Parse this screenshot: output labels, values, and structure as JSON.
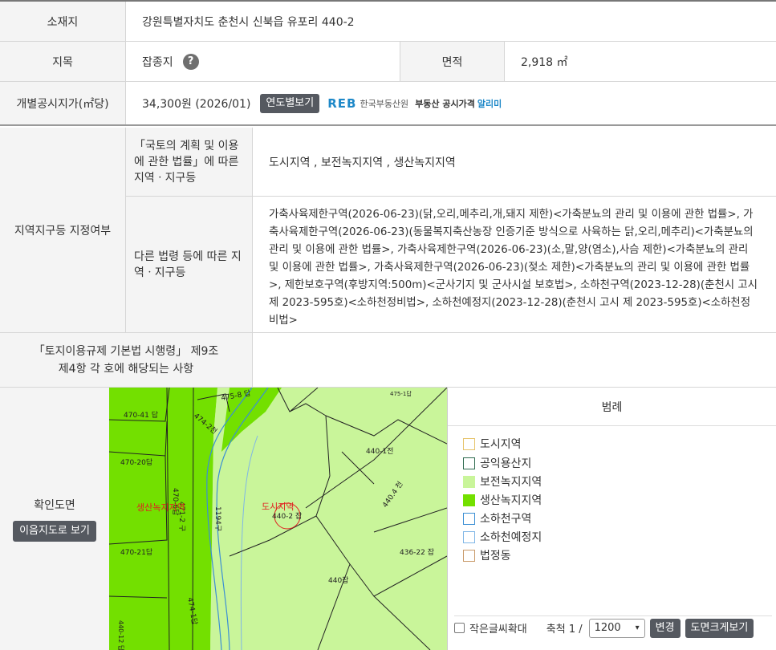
{
  "location": {
    "label": "소재지",
    "value": "강원특별자치도 춘천시 신북읍 유포리 440-2"
  },
  "land_category": {
    "label": "지목",
    "value": "잡종지",
    "help_icon": "question-circle-icon",
    "help_glyph": "?"
  },
  "area": {
    "label": "면적",
    "value": "2,918 ㎡"
  },
  "official_price": {
    "label": "개별공시지가(㎡당)",
    "value": "34,300원 (2026/01)",
    "button": "연도별보기",
    "reb_mark": "RE",
    "reb_mark_accent": "B",
    "reb_name": "한국부동산원",
    "reb_service": "부동산 공시가격",
    "reb_service_accent": "알리미"
  },
  "zoning": {
    "label": "지역지구등 지정여부",
    "national_plan_label": "「국토의 계획 및 이용에 관한 법률」에 따른 지역ㆍ지구등",
    "national_plan_value": "도시지역 , 보전녹지지역 , 생산녹지지역",
    "other_laws_label": "다른 법령 등에 따른 지역ㆍ지구등",
    "other_laws_value": "가축사육제한구역(2026-06-23)(닭,오리,메추리,개,돼지 제한)<가축분뇨의 관리 및 이용에 관한 법률>, 가축사육제한구역(2026-06-23)(동물복지축산농장 인증기준 방식으로 사육하는 닭,오리,메추리)<가축분뇨의 관리 및 이용에 관한 법률>, 가축사육제한구역(2026-06-23)(소,말,양(염소),사슴 제한)<가축분뇨의 관리 및 이용에 관한 법률>, 가축사육제한구역(2026-06-23)(젖소 제한)<가축분뇨의 관리 및 이용에 관한 법률>, 제한보호구역(후방지역:500m)<군사기지 및 군사시설 보호법>, 소하천구역(2023-12-28)(춘천시 고시 제 2023-595호)<소하천정비법>, 소하천예정지(2023-12-28)(춘천시 고시 제 2023-595호)<소하천정비법>"
  },
  "enforcement": {
    "label": "「토지이용규제 기본법 시행령」 제9조 제4항 각 호에 해당되는 사항",
    "value": ""
  },
  "map_section": {
    "label": "확인도면",
    "view_button": "이음지도로 보기",
    "parcels": [
      "470-41 답",
      "470-20답",
      "470-21답",
      "470-6답",
      "475-8 답",
      "474-2천",
      "440-1전",
      "440-2 잡",
      "440.4 천",
      "436-22 잡",
      "440잡",
      "1194구",
      "471-2 구",
      "474-1답",
      "475-1답",
      "440-12 답"
    ],
    "zone_labels": [
      "생산녹지지역",
      "도시지역"
    ]
  },
  "legend": {
    "title": "범례",
    "items": [
      {
        "label": "도시지역",
        "fill": "#ffffff",
        "border": "#e6c36a"
      },
      {
        "label": "공익용산지",
        "fill": "#ffffff",
        "border": "#2f6b4f"
      },
      {
        "label": "보전녹지지역",
        "fill": "#c9f59a",
        "border": "#c9f59a"
      },
      {
        "label": "생산녹지지역",
        "fill": "#73e000",
        "border": "#73e000"
      },
      {
        "label": "소하천구역",
        "fill": "#ffffff",
        "border": "#3b8fd4"
      },
      {
        "label": "소하천예정지",
        "fill": "#ffffff",
        "border": "#7fb6e6"
      },
      {
        "label": "법정동",
        "fill": "#ffffff",
        "border": "#c99a6a"
      }
    ]
  },
  "map_controls": {
    "enlarge_text_label": "작은글씨확대",
    "scale_label": "축척 1 /",
    "scale_value": "1200",
    "change_button": "변경",
    "large_map_button": "도면크게보기"
  }
}
